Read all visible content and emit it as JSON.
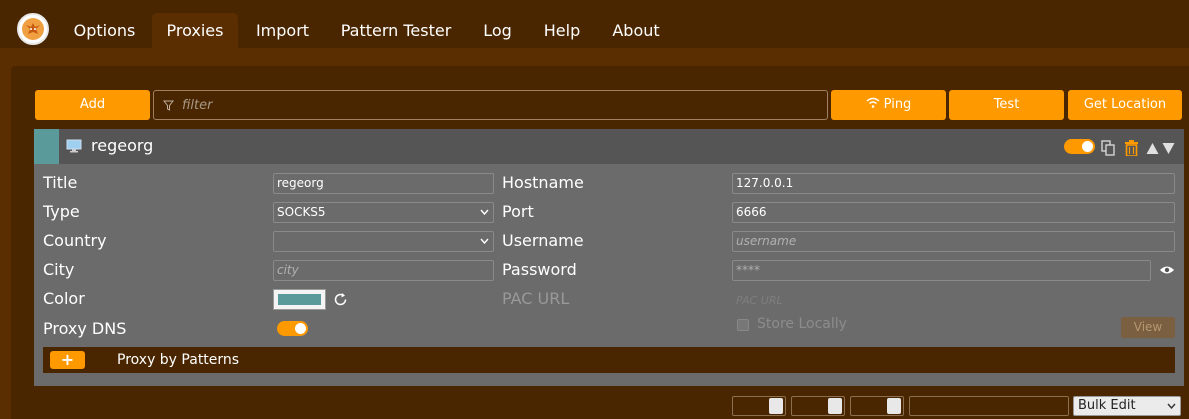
{
  "nav": {
    "tabs": [
      "Options",
      "Proxies",
      "Import",
      "Pattern Tester",
      "Log",
      "Help",
      "About"
    ],
    "active_tab": "Proxies"
  },
  "toolbar": {
    "add_label": "Add",
    "filter_placeholder": "filter",
    "ping_label": "Ping",
    "test_label": "Test",
    "get_location_label": "Get Location"
  },
  "proxy": {
    "name": "regeorg",
    "enabled": true,
    "color": "#5a9a9a",
    "fields": {
      "title_label": "Title",
      "title_value": "regeorg",
      "type_label": "Type",
      "type_value": "SOCKS5",
      "country_label": "Country",
      "country_value": "",
      "city_label": "City",
      "city_placeholder": "city",
      "color_label": "Color",
      "proxy_dns_label": "Proxy DNS",
      "hostname_label": "Hostname",
      "hostname_value": "127.0.0.1",
      "port_label": "Port",
      "port_value": "6666",
      "username_label": "Username",
      "username_placeholder": "username",
      "password_label": "Password",
      "password_placeholder": "****",
      "pac_url_label": "PAC URL",
      "pac_url_placeholder": "PAC URL",
      "store_locally_label": "Store Locally",
      "view_label": "View"
    },
    "patterns_label": "Proxy by Patterns",
    "add_pattern_label": "+"
  },
  "bottom": {
    "bulk_edit_label": "Bulk Edit"
  },
  "colors": {
    "accent": "#ff9900",
    "background": "#5a2e00",
    "panel": "#4a2600",
    "card": "#6b6b6b"
  }
}
